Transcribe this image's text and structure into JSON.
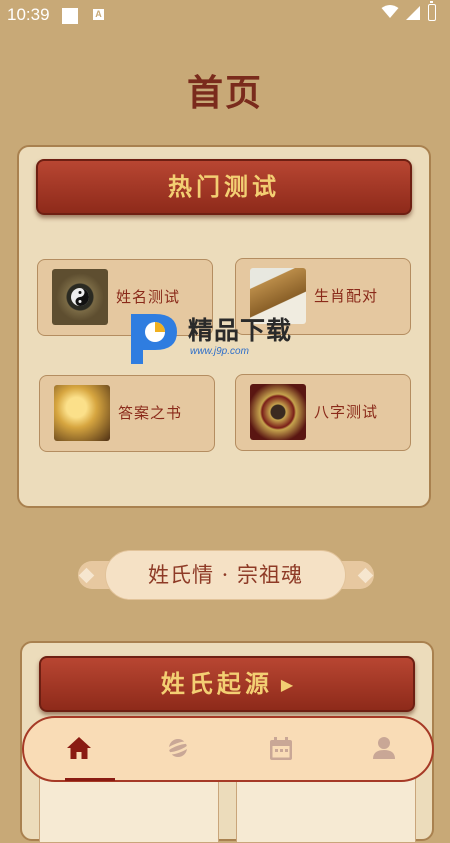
{
  "status_bar": {
    "time": "10:39",
    "notif_letter": "A"
  },
  "page": {
    "title": "首页"
  },
  "hot_tests": {
    "title": "热门测试",
    "items": [
      {
        "label": "姓名测试",
        "icon": "bagua-compass-icon"
      },
      {
        "label": "生肖配对",
        "icon": "ancient-scroll-icon"
      },
      {
        "label": "答案之书",
        "icon": "glowing-book-icon"
      },
      {
        "label": "八字测试",
        "icon": "fengshui-compass-icon"
      }
    ]
  },
  "watermark": {
    "text": "精品下载",
    "url": "www.j9p.com"
  },
  "slogan": "姓氏情 · 宗祖魂",
  "surname_origin": {
    "title": "姓氏起源",
    "arrow": "▶"
  },
  "nav": {
    "items": [
      {
        "name": "home",
        "active": true
      },
      {
        "name": "discover",
        "active": false
      },
      {
        "name": "calendar",
        "active": false
      },
      {
        "name": "profile",
        "active": false
      }
    ]
  },
  "colors": {
    "background": "#c8a977",
    "banner_red": "#9e3421",
    "banner_text": "#f3cf73",
    "label_red": "#8a2a1a",
    "nav_active": "#8a1b12",
    "nav_inactive": "#c9a796"
  }
}
